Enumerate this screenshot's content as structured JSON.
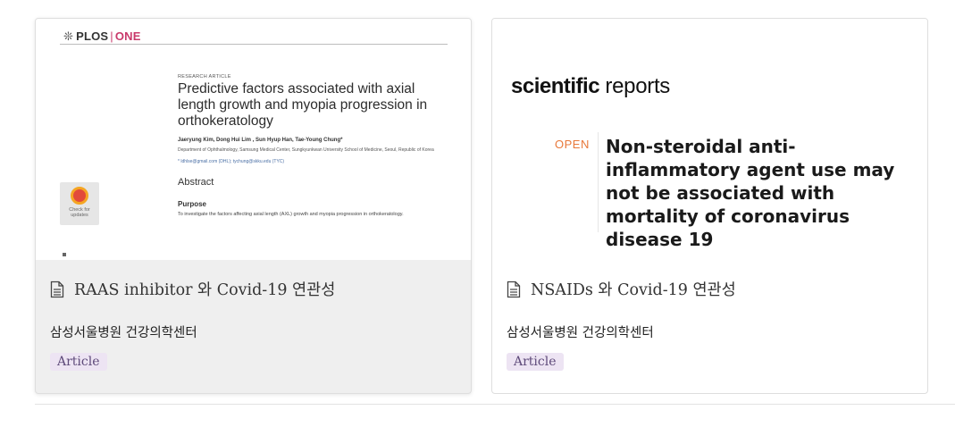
{
  "cards": [
    {
      "title": "RAAS inhibitor 와 Covid-19 연관성",
      "subtitle": "삼성서울병원 건강의학센터",
      "badge": "Article",
      "icon": "document-icon",
      "thumbnail": {
        "journal_mark": "❊",
        "journal_plos": "PLOS",
        "journal_sep": "|",
        "journal_one": "ONE",
        "label": "RESEARCH ARTICLE",
        "title": "Predictive factors associated with axial length growth and myopia progression in orthokeratology",
        "authors": "Jaeryung Kim, Dong Hui Lim , Sun Hyup Han, Tae-Young Chung*",
        "affiliation": "Department of Ophthalmology, Samsung Medical Center, Sungkyunkwan University School of Medicine, Seoul, Republic of Korea",
        "email": "* ldhlse@gmail.com (DHL); tychung@skku.edu (TYC)",
        "check_badge": "Check for updates",
        "abstract_heading": "Abstract",
        "purpose_heading": "Purpose",
        "purpose_text": "To investigate the factors affecting axial length (AXL) growth and myopia progression in orthokeratology."
      }
    },
    {
      "title": "NSAIDs 와 Covid-19 연관성",
      "subtitle": "삼성서울병원 건강의학센터",
      "badge": "Article",
      "icon": "document-icon",
      "thumbnail": {
        "journal_bold": "scientific",
        "journal_rest": " reports",
        "open_label": "OPEN",
        "title": "Non-steroidal anti-inflammatory agent use may not be associated with mortality of coronavirus disease 19"
      }
    }
  ],
  "colors": {
    "badge_bg": "#ede4f3",
    "badge_text": "#5e4a7a",
    "plos_accent": "#c93a6b",
    "open_orange": "#e8783a",
    "hover_bg": "#efefef"
  }
}
